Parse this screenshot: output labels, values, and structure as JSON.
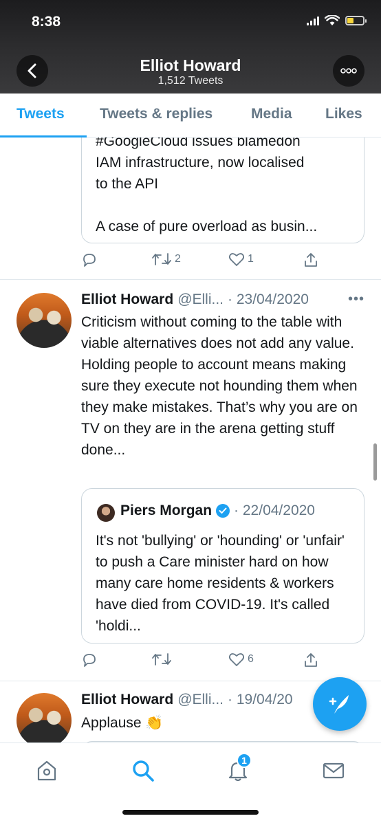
{
  "status_bar": {
    "time": "8:38",
    "battery_level": 0.4
  },
  "header": {
    "title": "Elliot Howard",
    "subtitle": "1,512 Tweets",
    "back_icon": "chevron-left-icon",
    "more_icon": "more-icon"
  },
  "tabs": [
    {
      "label": "Tweets",
      "active": true
    },
    {
      "label": "Tweets & replies",
      "active": false
    },
    {
      "label": "Media",
      "active": false
    },
    {
      "label": "Likes",
      "active": false
    }
  ],
  "tweets": [
    {
      "quote": {
        "partial_line": "#GoogleCloud issues blamedon",
        "text": "IAM infrastructure, now localised\nto the API\n\nA case of pure overload as busin..."
      },
      "actions": {
        "reply": "",
        "retweet": "2",
        "like": "1"
      }
    },
    {
      "author": "Elliot Howard",
      "handle": "@Elli...",
      "date": "· 23/04/2020",
      "text": "Criticism without coming to the table with viable alternatives does not add any value. Holding people to account means making sure they execute not hounding them when they make mistakes. That’s why you are on TV on they are in the arena getting stuff done...",
      "quote": {
        "author": "Piers Morgan",
        "date": "· 22/04/2020",
        "text": "It's not 'bullying' or 'hounding' or 'unfair' to push a Care minister hard on how many care home residents & workers have died from COVID-19. It's called 'holdi..."
      },
      "actions": {
        "reply": "",
        "retweet": "",
        "like": "6"
      }
    },
    {
      "author": "Elliot Howard",
      "handle": "@Elli...",
      "date": "· 19/04/20",
      "text": "Applause 👏"
    }
  ],
  "fab": {
    "icon": "compose-tweet-icon"
  },
  "bottom_nav": [
    {
      "name": "home",
      "icon": "home-icon"
    },
    {
      "name": "search",
      "icon": "search-icon",
      "active": true
    },
    {
      "name": "notifications",
      "icon": "bell-icon",
      "badge": "1"
    },
    {
      "name": "messages",
      "icon": "mail-icon"
    }
  ],
  "colors": {
    "accent": "#1da1f2",
    "muted": "#657786",
    "text": "#14171a",
    "divider": "#e1e8ed"
  }
}
